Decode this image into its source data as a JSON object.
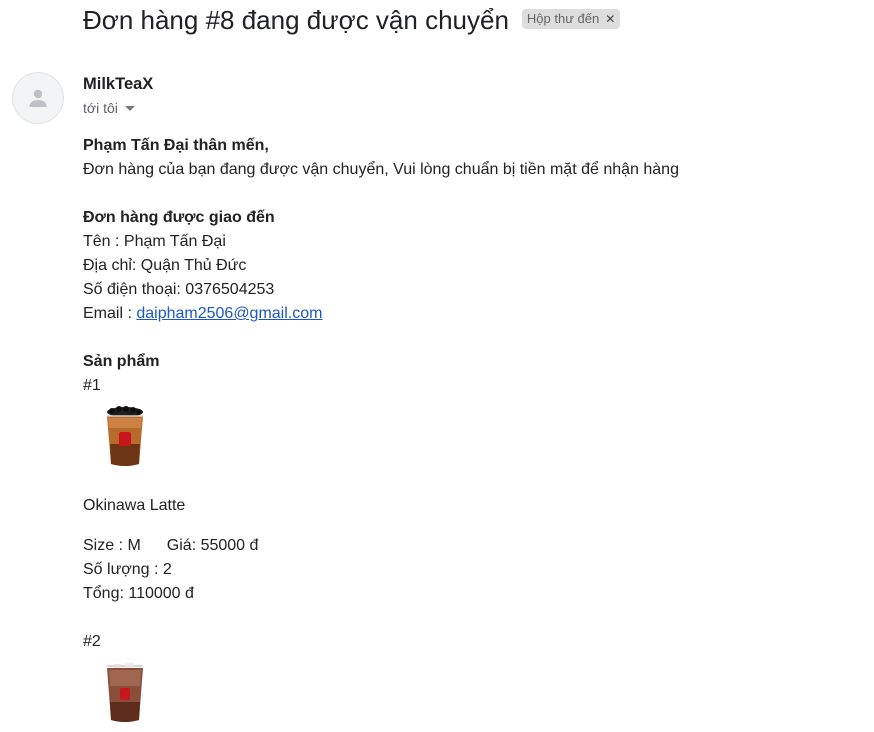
{
  "email": {
    "subject": "Đơn hàng #8 đang được vận chuyển",
    "label": "Hộp thư đến",
    "sender": "MilkTeaX",
    "recipient": "tới tôi"
  },
  "content": {
    "greeting": "Phạm Tấn Đại thân mến,",
    "message": "Đơn hàng của bạn đang được vận chuyển, Vui lòng chuẩn bị tiền mặt để nhận hàng",
    "delivery_heading": "Đơn hàng được giao đến",
    "name_line": "Tên : Phạm Tấn Đại",
    "address_line": "Địa chỉ: Quận Thủ Đức",
    "phone_line": "Số điện thoại: 0376504253",
    "email_label": "Email : ",
    "email_value": "daipham2506@gmail.com",
    "products_heading": "Sản phẩm",
    "products": [
      {
        "index": "#1",
        "name": "Okinawa Latte",
        "size": "Size : M",
        "price": "Giá: 55000 đ",
        "quantity": "Số lượng : 2",
        "total": "Tổng: 110000 đ"
      },
      {
        "index": "#2"
      }
    ]
  }
}
